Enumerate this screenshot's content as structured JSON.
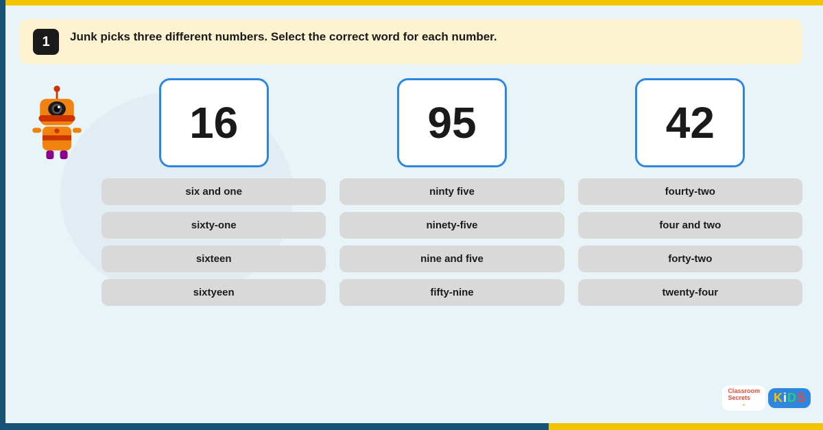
{
  "topBar": {
    "color": "#f5c400"
  },
  "question": {
    "number": "1",
    "text": "Junk picks three different numbers. Select the correct word for each number."
  },
  "numbers": [
    {
      "value": "16",
      "options": [
        "six and one",
        "sixty-one",
        "sixteen",
        "sixtyeen"
      ]
    },
    {
      "value": "95",
      "options": [
        "ninty five",
        "ninety-five",
        "nine and five",
        "fifty-nine"
      ]
    },
    {
      "value": "42",
      "options": [
        "fourty-two",
        "four and two",
        "forty-two",
        "twenty-four"
      ]
    }
  ],
  "branding": {
    "classroomSecrets": "Classroom\nSecrets",
    "kids": "KiDS"
  }
}
